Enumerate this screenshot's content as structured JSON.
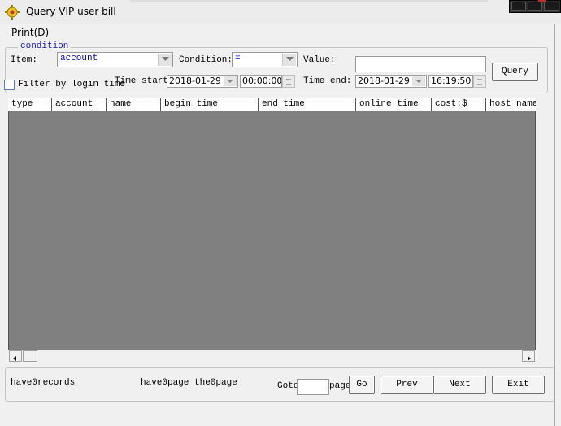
{
  "window": {
    "title": "Query VIP user bill",
    "icon": "gear-sun-icon"
  },
  "menu": {
    "print": "Print(D)"
  },
  "condition": {
    "legend": "condition",
    "item_label": "Item:",
    "item_value": "account",
    "condition_label": "Condition:",
    "condition_value": "=",
    "value_label": "Value:",
    "value_input": "",
    "query_button": "Query",
    "filter_checkbox_label": "Filter by login time",
    "filter_checked": false,
    "time_start_label": "Time start:",
    "time_start_date": "2018-01-29",
    "time_start_time": "00:00:00",
    "time_end_label": "Time end:",
    "time_end_date": "2018-01-29",
    "time_end_time": "16:19:50"
  },
  "table": {
    "columns": [
      "type",
      "account",
      "name",
      "begin time",
      "end time",
      "online time",
      "cost:$",
      "host name"
    ],
    "rows": []
  },
  "footer": {
    "records_text": "have0records",
    "pages_text": "have0page",
    "current_page_text": "the0page",
    "goto_label": "Goto",
    "goto_value": "",
    "page_label": "page",
    "go_button": "Go",
    "prev_button": "Prev",
    "next_button": "Next",
    "exit_button": "Exit"
  },
  "colors": {
    "grid_background": "#808080",
    "legend_text": "#1a1ab8",
    "combo_text": "#0000cc"
  }
}
